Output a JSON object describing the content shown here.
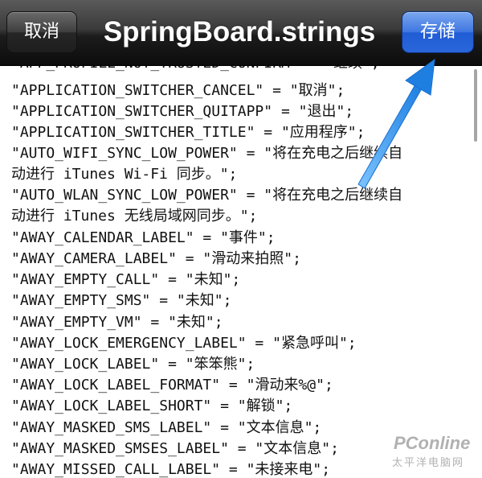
{
  "navbar": {
    "cancel_label": "取消",
    "title": "SpringBoard.strings",
    "save_label": "存储"
  },
  "lines": [
    "\"APP_PROFILE_NOT_TRUSTED_CONFIRM\" = \"继续\";",
    "\"APPLICATION_SWITCHER_CANCEL\" = \"取消\";",
    "\"APPLICATION_SWITCHER_QUITAPP\" = \"退出\";",
    "\"APPLICATION_SWITCHER_TITLE\" = \"应用程序\";",
    "\"AUTO_WIFI_SYNC_LOW_POWER\" = \"将在充电之后继续自",
    "动进行 iTunes Wi-Fi 同步。\";",
    "\"AUTO_WLAN_SYNC_LOW_POWER\" = \"将在充电之后继续自",
    "动进行 iTunes 无线局域网同步。\";",
    "\"AWAY_CALENDAR_LABEL\" = \"事件\";",
    "\"AWAY_CAMERA_LABEL\" = \"滑动来拍照\";",
    "\"AWAY_EMPTY_CALL\" = \"未知\";",
    "\"AWAY_EMPTY_SMS\" = \"未知\";",
    "\"AWAY_EMPTY_VM\" = \"未知\";",
    "\"AWAY_LOCK_EMERGENCY_LABEL\" = \"紧急呼叫\";",
    "\"AWAY_LOCK_LABEL\" = \"笨笨熊\";",
    "\"AWAY_LOCK_LABEL_FORMAT\" = \"滑动来%@\";",
    "\"AWAY_LOCK_LABEL_SHORT\" = \"解锁\";",
    "\"AWAY_MASKED_SMS_LABEL\" = \"文本信息\";",
    "\"AWAY_MASKED_SMSES_LABEL\" = \"文本信息\";",
    "\"AWAY_MISSED_CALL_LABEL\" = \"未接来电\";"
  ],
  "watermark": {
    "main": "PConline",
    "sub": "太平洋电脑网"
  },
  "colors": {
    "save_button": "#2a66db",
    "annotation_arrow": "#2f8fe6"
  },
  "icons": {
    "annotation": "arrow-annotation-icon"
  }
}
